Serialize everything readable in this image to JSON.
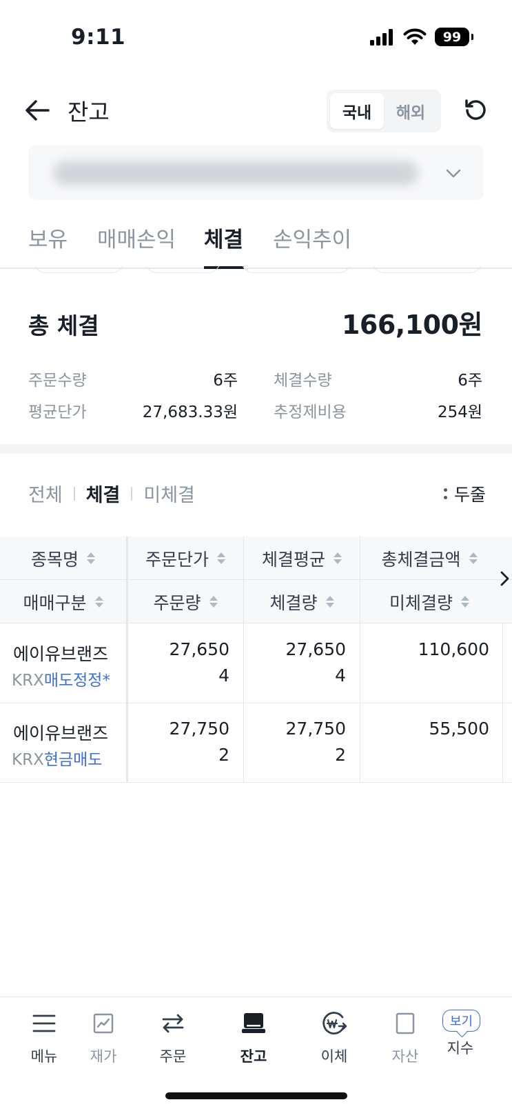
{
  "status_bar": {
    "time": "9:11",
    "battery": "99"
  },
  "header": {
    "title": "잔고",
    "segments": [
      "국내",
      "해외"
    ],
    "active_segment": "국내"
  },
  "account": {
    "selector_value": ""
  },
  "tabs": [
    "보유",
    "매매손익",
    "체결",
    "손익추이"
  ],
  "active_tab": "체결",
  "summary": {
    "title": "총 체결",
    "total": "166,100원",
    "order_qty_label": "주문수량",
    "order_qty": "6주",
    "exec_qty_label": "체결수량",
    "exec_qty": "6주",
    "avg_price_label": "평균단가",
    "avg_price": "27,683.33원",
    "est_cost_label": "추정제비용",
    "est_cost": "254원"
  },
  "filter": {
    "options": [
      "전체",
      "체결",
      "미체결"
    ],
    "active": "체결",
    "two_line_label": "두줄"
  },
  "table": {
    "header_row1": [
      "종목명",
      "주문단가",
      "체결평균",
      "총체결금액"
    ],
    "header_row2": [
      "매매구분",
      "주문량",
      "체결량",
      "미체결량"
    ],
    "rows": [
      {
        "name": "에이유브랜즈",
        "market": "KRX",
        "type": "매도정정*",
        "order_price": "27,650",
        "order_qty": "4",
        "avg_exec": "27,650",
        "exec_qty": "4",
        "total": "110,600",
        "unfilled": ""
      },
      {
        "name": "에이유브랜즈",
        "market": "KRX",
        "type": "현금매도",
        "order_price": "27,750",
        "order_qty": "2",
        "avg_exec": "27,750",
        "exec_qty": "2",
        "total": "55,500",
        "unfilled": ""
      }
    ]
  },
  "bottom_nav": {
    "items": [
      "메뉴",
      "재가",
      "주문",
      "잔고",
      "이체",
      "자산",
      "지수"
    ],
    "active": "잔고",
    "badge": "보기"
  },
  "colors": {
    "accent_blue": "#3a6fd8",
    "text_primary": "#191f28",
    "text_secondary": "#8b95a1"
  }
}
